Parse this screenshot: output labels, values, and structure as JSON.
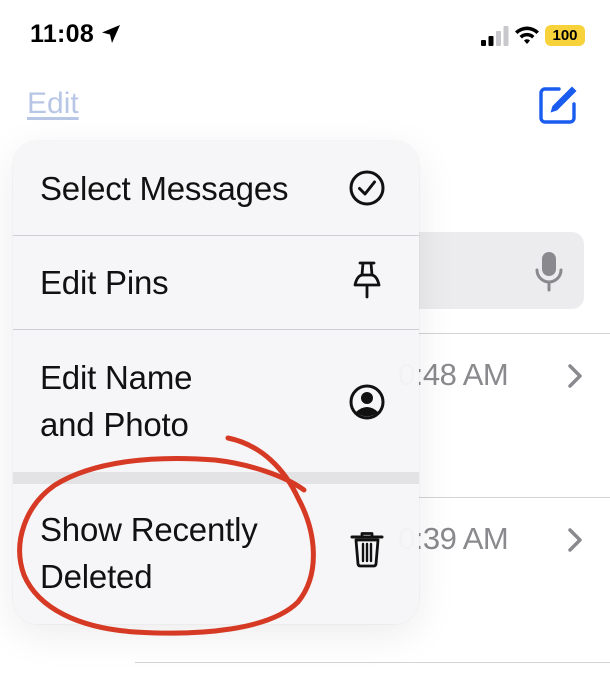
{
  "status_bar": {
    "time": "11:08",
    "battery": "100"
  },
  "nav": {
    "edit_label": "Edit"
  },
  "background_list": {
    "rows": [
      {
        "time": "0:48 AM"
      },
      {
        "time": "0:39 AM"
      }
    ]
  },
  "menu": {
    "items": [
      {
        "label": "Select Messages",
        "icon": "checkmark-circle-icon"
      },
      {
        "label": "Edit Pins",
        "icon": "pin-icon"
      },
      {
        "label_lines": [
          "Edit Name",
          "and Photo"
        ],
        "icon": "person-circle-icon"
      },
      {
        "label_lines": [
          "Show Recently",
          "Deleted"
        ],
        "icon": "trash-icon"
      }
    ]
  },
  "colors": {
    "accent": "#1a5cf0",
    "edit_link": "#b8c6e6",
    "annotation": "#d63a24",
    "battery": "#f7d23b"
  }
}
